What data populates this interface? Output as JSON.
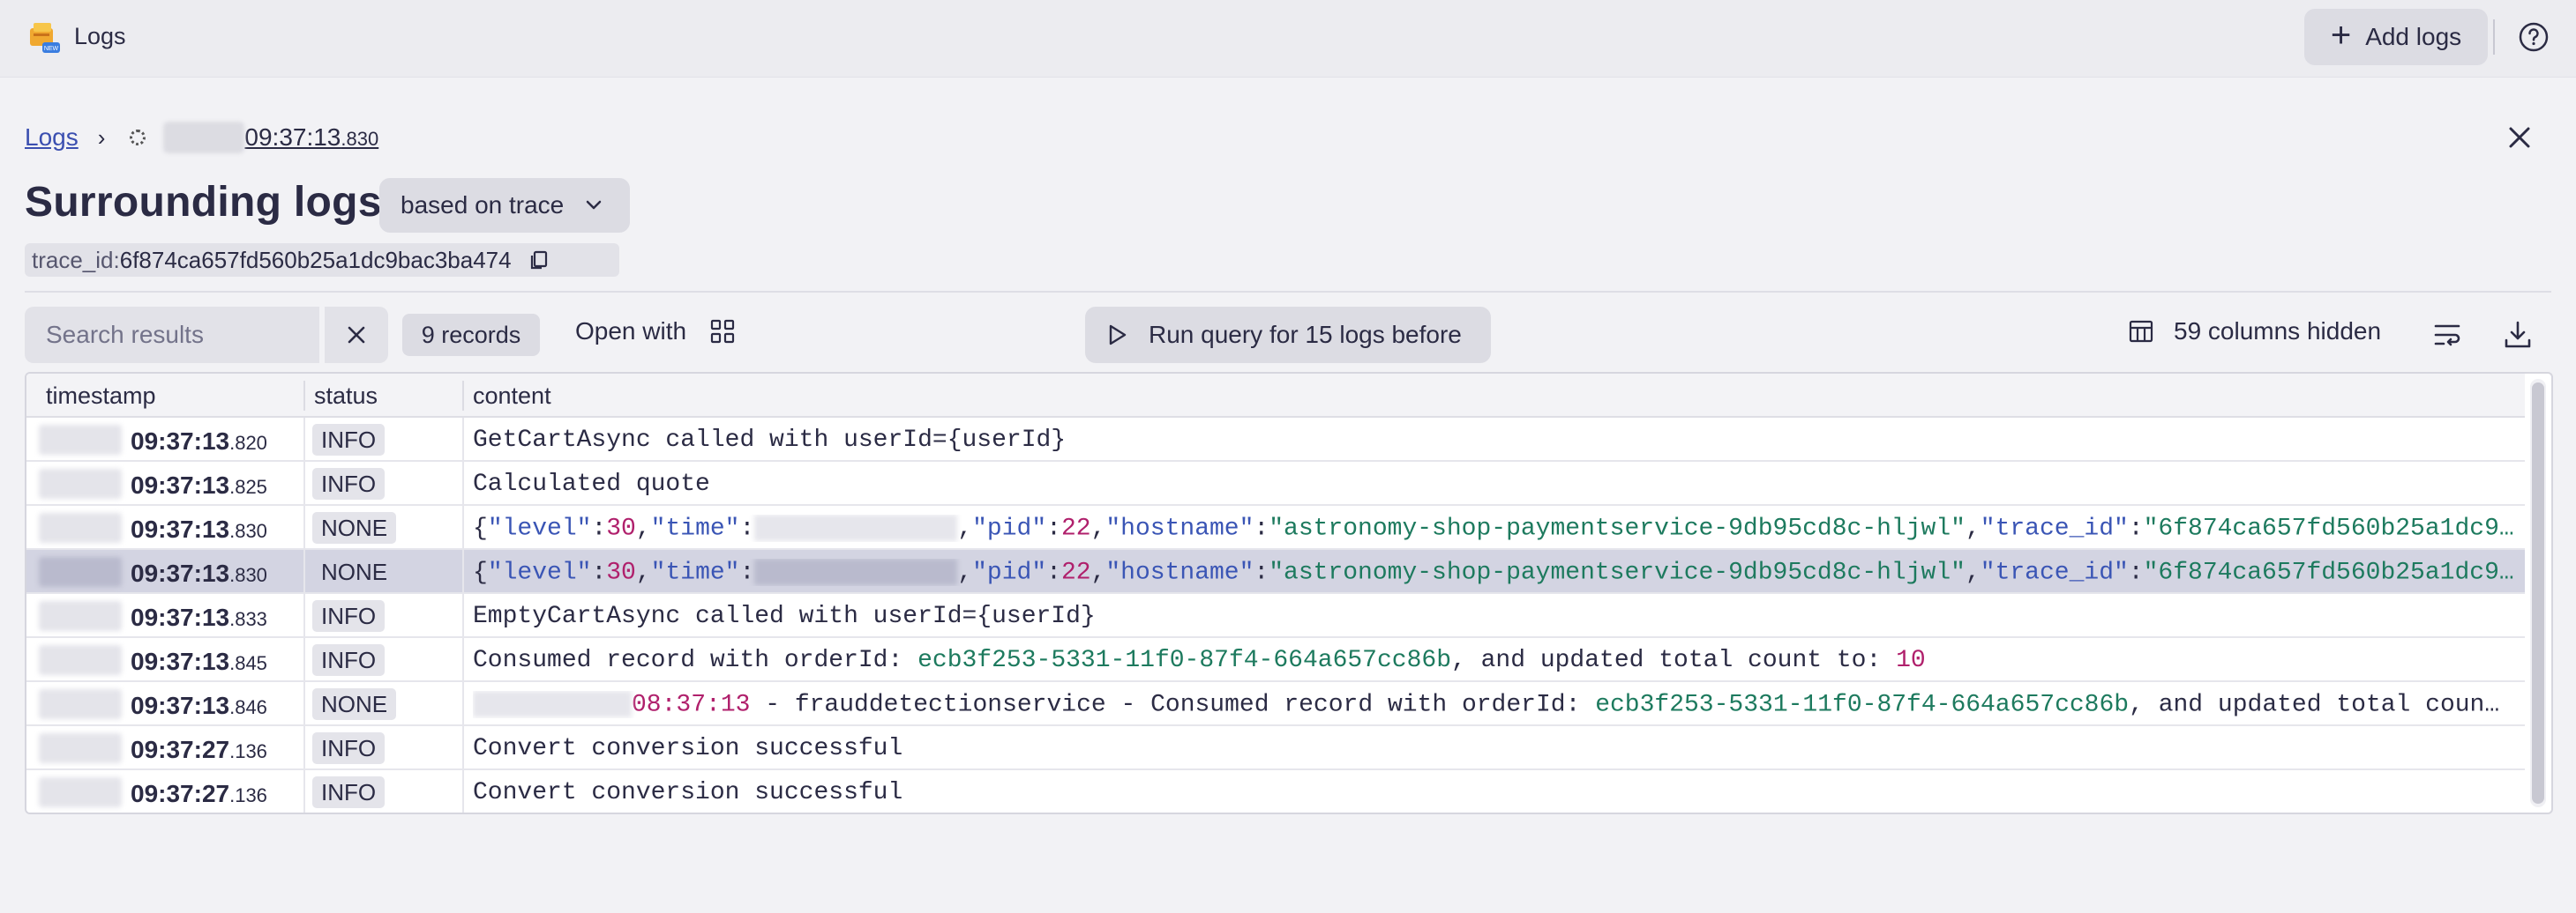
{
  "topbar": {
    "app_title": "Logs",
    "add_logs_label": "Add logs"
  },
  "breadcrumb": {
    "root": "Logs",
    "current_time": "09:37:13",
    "current_ms": ".830"
  },
  "title": "Surrounding logs",
  "based_on": "based on trace",
  "trace": {
    "key": "trace_id:",
    "value": "6f874ca657fd560b25a1dc9bac3ba474"
  },
  "toolbar": {
    "search_placeholder": "Search results",
    "records": "9 records",
    "open_with": "Open with",
    "run_query": "Run query for 15 logs before",
    "columns_hidden": "59 columns hidden"
  },
  "table": {
    "headers": [
      "timestamp",
      "status",
      "content"
    ],
    "rows": [
      {
        "time": "09:37:13",
        "ms": ".820",
        "status": "INFO",
        "content": "GetCartAsync called with userId={userId}"
      },
      {
        "time": "09:37:13",
        "ms": ".825",
        "status": "INFO",
        "content": "Calculated quote"
      },
      {
        "time": "09:37:13",
        "ms": ".830",
        "status": "NONE",
        "json": true
      },
      {
        "time": "09:37:13",
        "ms": ".830",
        "status": "NONE",
        "json": true,
        "selected": true
      },
      {
        "time": "09:37:13",
        "ms": ".833",
        "status": "INFO",
        "content": "EmptyCartAsync called with userId={userId}"
      },
      {
        "time": "09:37:13",
        "ms": ".845",
        "status": "INFO",
        "content_prefix": "Consumed record with orderId: ",
        "order_id": "ecb3f253-5331-11f0-87f4-664a657cc86b",
        "content_mid": ", and updated total count to: ",
        "count": "10"
      },
      {
        "time": "09:37:13",
        "ms": ".846",
        "status": "NONE",
        "fraud_time": "08:37:13",
        "fraud_text": " - frauddetectionservice - Consumed record with orderId: ",
        "order_id": "ecb3f253-5331-11f0-87f4-664a657cc86b",
        "fraud_tail": ", and updated total coun…"
      },
      {
        "time": "09:37:27",
        "ms": ".136",
        "status": "INFO",
        "content": "Convert conversion successful"
      },
      {
        "time": "09:37:27",
        "ms": ".136",
        "status": "INFO",
        "content": "Convert conversion successful"
      }
    ],
    "json_row": {
      "level_key": "\"level\"",
      "level_val": "30",
      "time_key": "\"time\"",
      "pid_key": "\"pid\"",
      "pid_val": "22",
      "hostname_key": "\"hostname\"",
      "hostname_val": "\"astronomy-shop-paymentservice-9db95cd8c-hljwl\"",
      "trace_key": "\"trace_id\"",
      "trace_val": "\"6f874ca657fd560b25a1dc9…"
    }
  }
}
